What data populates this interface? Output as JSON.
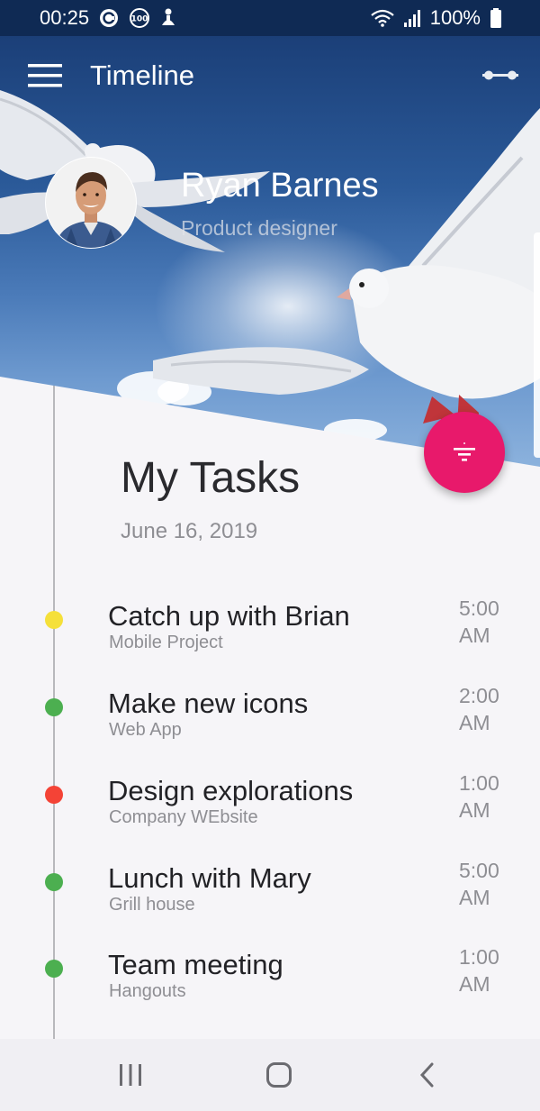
{
  "status_bar": {
    "time": "00:25",
    "battery": "100%",
    "notification_icons": [
      "c-circle-icon",
      "100-badge-icon",
      "person-icon"
    ],
    "system_icons": [
      "wifi-icon",
      "signal-icon",
      "battery-icon"
    ]
  },
  "appbar": {
    "title": "Timeline",
    "menu_icon": "hamburger-menu-icon",
    "action_icon": "tune-icon"
  },
  "profile": {
    "name": "Ryan Barnes",
    "role": "Product designer"
  },
  "tasks_section": {
    "title": "My Tasks",
    "date": "June 16, 2019",
    "fab_icon": "filter-list-icon",
    "fab_color": "#e8196b"
  },
  "tasks": [
    {
      "title": "Catch up with Brian",
      "subtitle": "Mobile Project",
      "time_value": "5:00",
      "time_period": "AM",
      "color": "#f5e03a"
    },
    {
      "title": "Make new icons",
      "subtitle": "Web App",
      "time_value": "2:00",
      "time_period": "AM",
      "color": "#4caf50"
    },
    {
      "title": "Design explorations",
      "subtitle": "Company WEbsite",
      "time_value": "1:00",
      "time_period": "AM",
      "color": "#f44336"
    },
    {
      "title": "Lunch with Mary",
      "subtitle": "Grill house",
      "time_value": "5:00",
      "time_period": "AM",
      "color": "#4caf50"
    },
    {
      "title": "Team meeting",
      "subtitle": "Hangouts",
      "time_value": "1:00",
      "time_period": "AM",
      "color": "#4caf50"
    }
  ],
  "navbar": {
    "recents_icon": "recents-icon",
    "home_icon": "home-icon",
    "back_icon": "back-icon"
  }
}
